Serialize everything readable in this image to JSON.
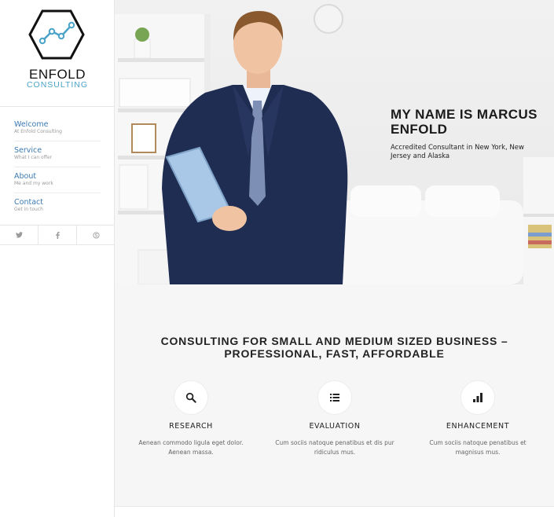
{
  "brand": {
    "title": "ENFOLD",
    "subtitle": "CONSULTING",
    "accent_color": "#4aa3c8",
    "logo_icon": "hexagon-line-chart-icon"
  },
  "nav": {
    "items": [
      {
        "label": "Welcome",
        "sub": "At Enfold Consulting"
      },
      {
        "label": "Service",
        "sub": "What I can offer"
      },
      {
        "label": "About",
        "sub": "Me and my work"
      },
      {
        "label": "Contact",
        "sub": "Get in touch"
      }
    ],
    "link_color": "#3b7ab3"
  },
  "social": {
    "icons": [
      "twitter-icon",
      "facebook-icon",
      "skype-icon"
    ]
  },
  "hero": {
    "title": "MY NAME IS MARCUS ENFOLD",
    "subtitle": "Accredited Consultant in New York, New Jersey and Alaska"
  },
  "main": {
    "tagline": "CONSULTING FOR SMALL AND MEDIUM SIZED BUSINESS – PROFESSIONAL, FAST, AFFORDABLE",
    "features": [
      {
        "icon": "search-icon",
        "title": "RESEARCH",
        "text": "Aenean commodo ligula eget dolor. Aenean massa."
      },
      {
        "icon": "list-icon",
        "title": "EVALUATION",
        "text": "Cum sociis natoque penatibus et dis pur ridiculus mus."
      },
      {
        "icon": "bar-chart-icon",
        "title": "ENHANCEMENT",
        "text": "Cum sociis natoque penatibus et magnisus mus."
      }
    ]
  }
}
